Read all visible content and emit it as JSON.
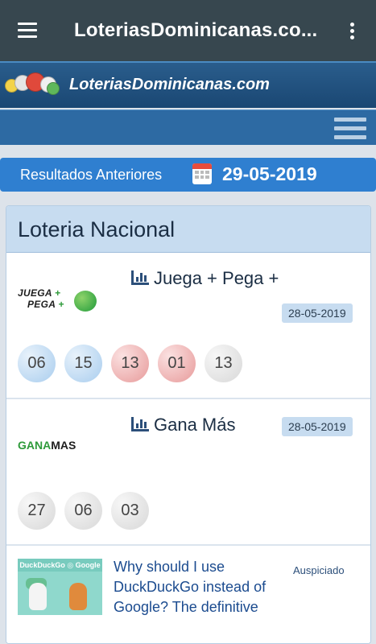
{
  "appbar": {
    "title": "LoteriasDominicanas.co..."
  },
  "site": {
    "brand": "LoteriasDominicanas.com"
  },
  "results": {
    "label": "Resultados Anteriores",
    "date": "29-05-2019"
  },
  "panel": {
    "title": "Loteria Nacional",
    "games": [
      {
        "name": "Juega + Pega +",
        "date": "28-05-2019",
        "logo_line1": "JUEGA",
        "logo_line2": "PEGA",
        "numbers": [
          {
            "value": "06",
            "color": "blue"
          },
          {
            "value": "15",
            "color": "blue"
          },
          {
            "value": "13",
            "color": "red"
          },
          {
            "value": "01",
            "color": "red"
          },
          {
            "value": "13",
            "color": "gray"
          }
        ]
      },
      {
        "name": "Gana Más",
        "date": "28-05-2019",
        "logo_g": "G",
        "logo_ana": "ANA",
        "logo_mas": "MAS",
        "numbers": [
          {
            "value": "27",
            "color": "gray"
          },
          {
            "value": "06",
            "color": "gray"
          },
          {
            "value": "03",
            "color": "gray"
          }
        ]
      }
    ]
  },
  "ad": {
    "thumb_header": "DuckDuckGo ◎ Google",
    "text": "Why should I use DuckDuckGo instead of Google? The definitive",
    "sponsored": "Auspiciado"
  },
  "colors": {
    "appbar": "#37474f",
    "date_bar": "#2f7fd0",
    "panel_header": "#c7dcf0"
  },
  "icons": [
    "menu-icon",
    "more-vert-icon",
    "hamburger-icon",
    "calendar-icon",
    "bar-chart-icon"
  ]
}
